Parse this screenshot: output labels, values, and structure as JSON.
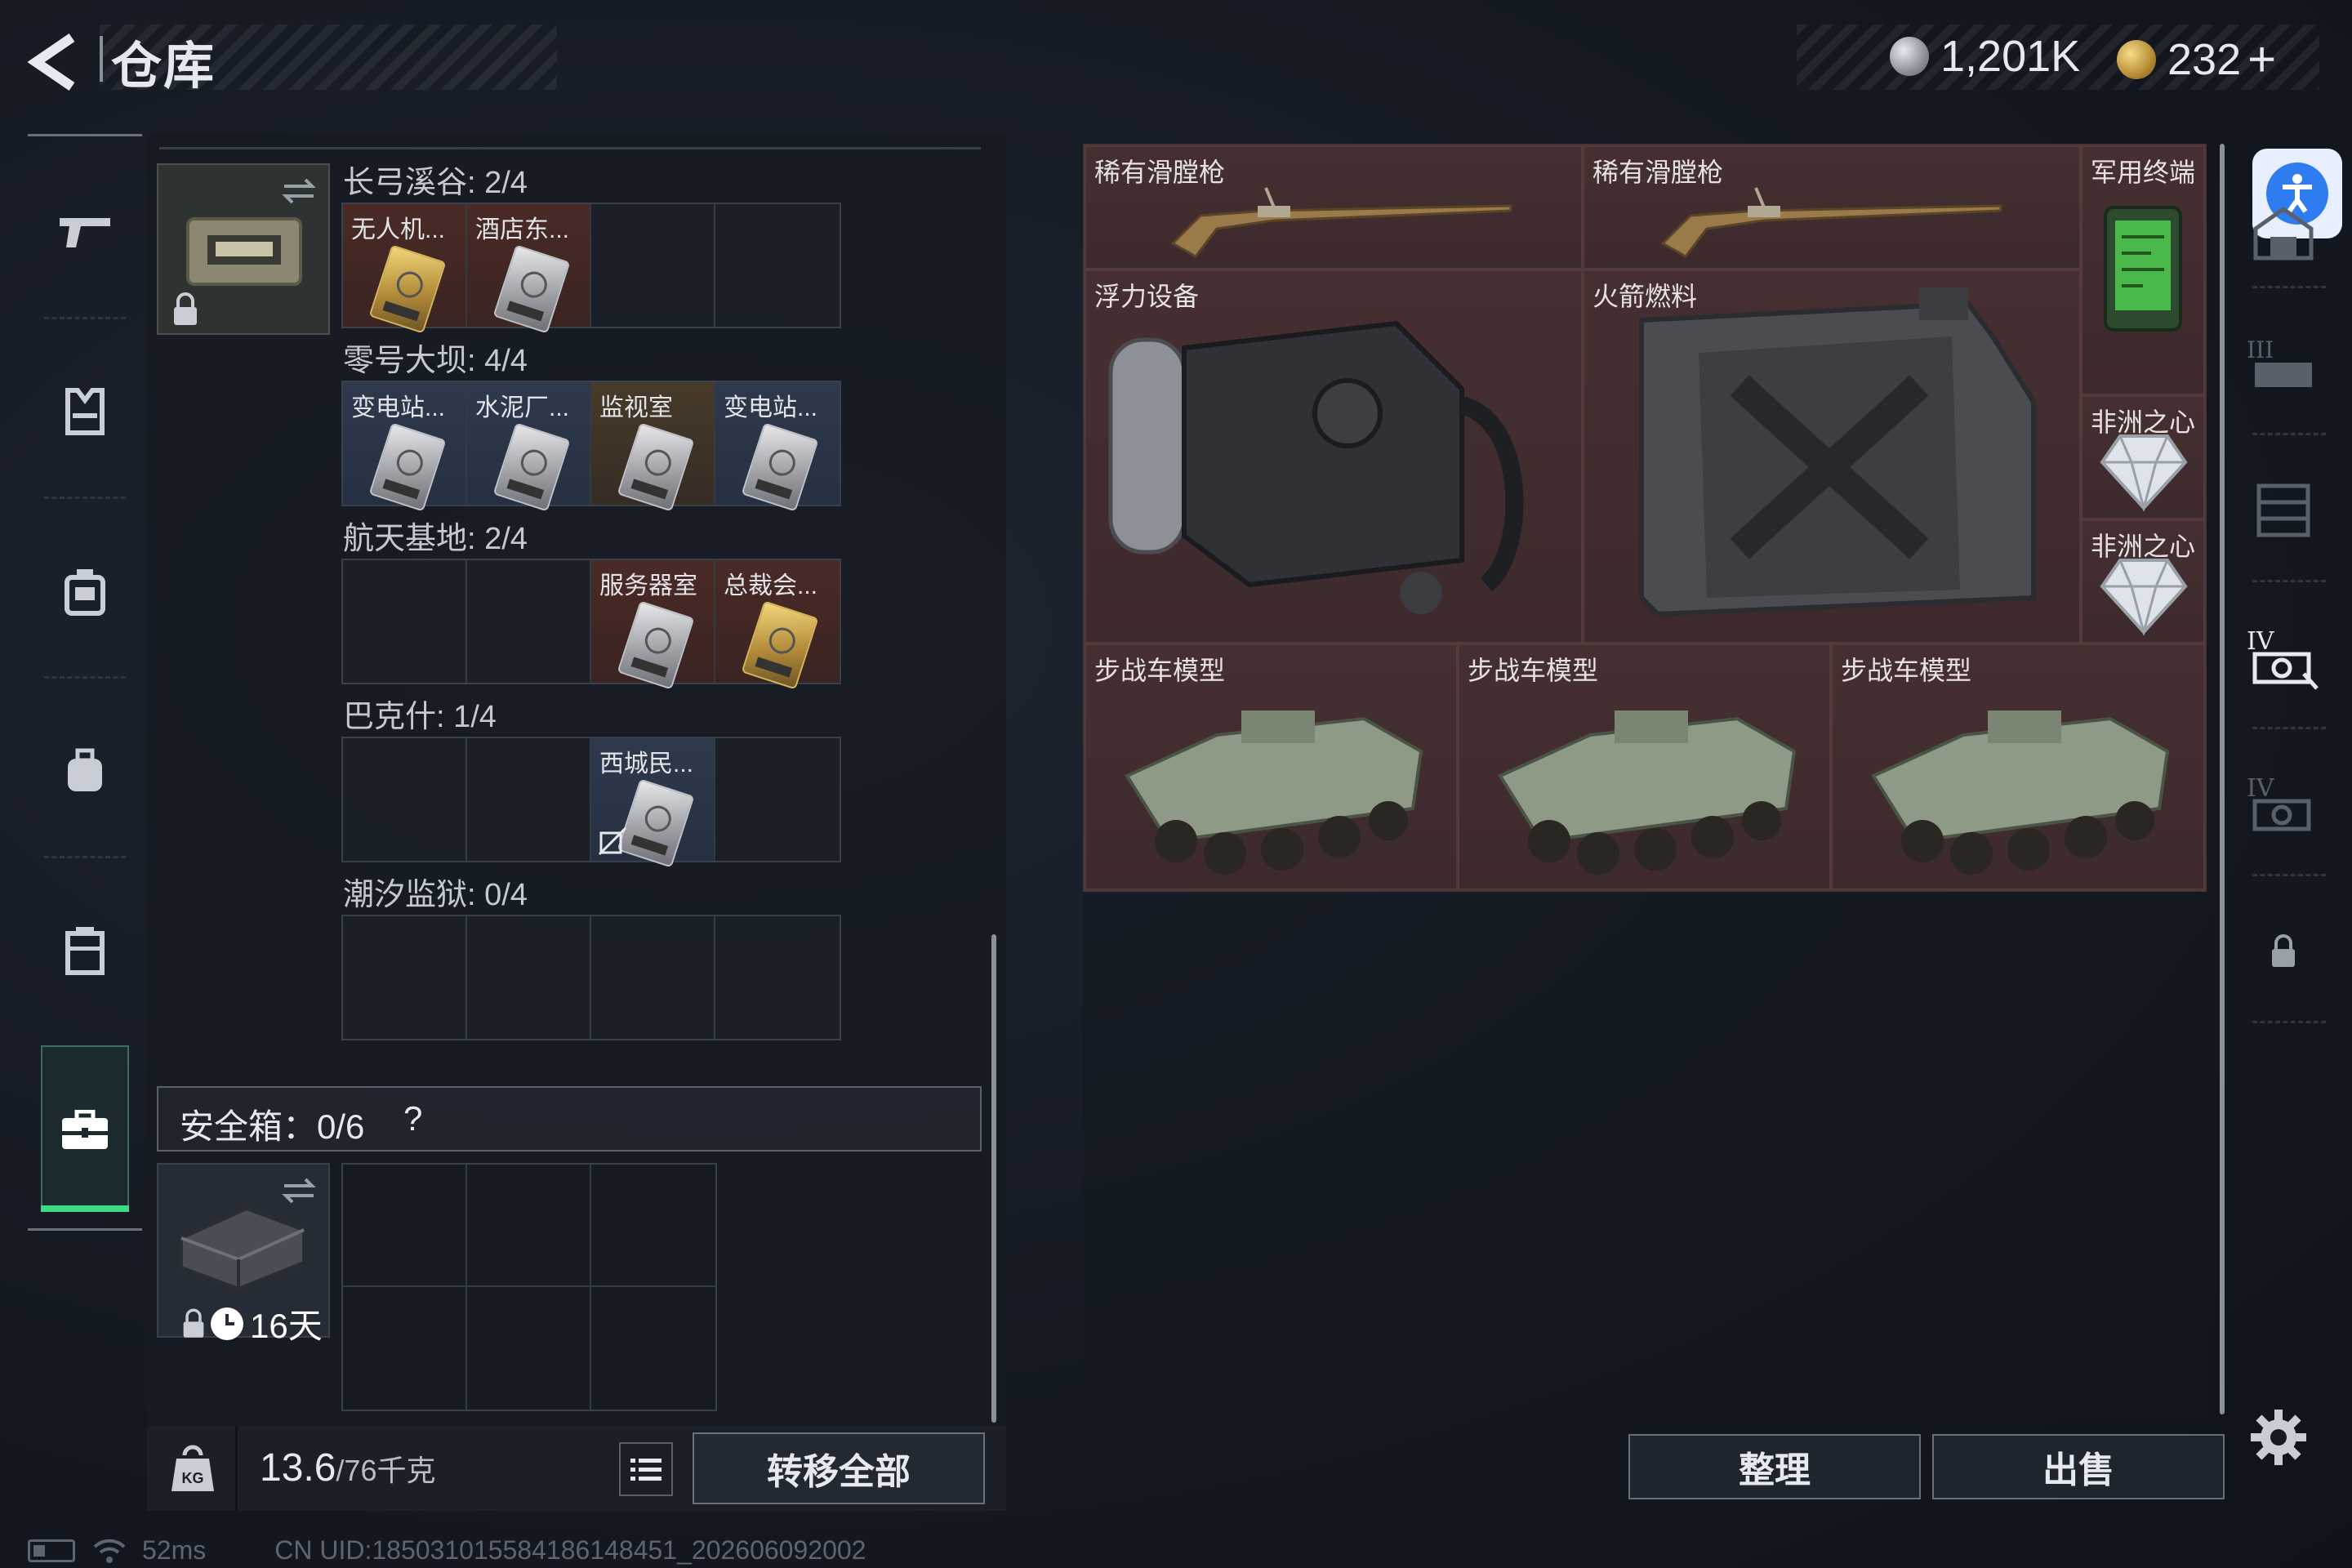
{
  "header": {
    "title": "仓库",
    "currency_silver": "1,201K",
    "currency_gold": "232",
    "currency_plus": "+"
  },
  "sidebar": {
    "items": [
      {
        "name": "weapons-tab",
        "icon": "gun-icon"
      },
      {
        "name": "armor-tab",
        "icon": "armor-vest-icon"
      },
      {
        "name": "rig-tab",
        "icon": "chest-rig-icon"
      },
      {
        "name": "backpack-tab",
        "icon": "backpack-icon"
      },
      {
        "name": "container-tab",
        "icon": "container-icon"
      },
      {
        "name": "case-tab",
        "icon": "briefcase-icon",
        "active": true
      }
    ]
  },
  "keycard_groups": [
    {
      "label": "长弓溪谷: 2/4",
      "cells": [
        {
          "label": "无人机...",
          "tone": "red",
          "card": "gold"
        },
        {
          "label": "酒店东...",
          "tone": "red",
          "card": "silver"
        },
        {
          "label": "",
          "tone": "",
          "card": ""
        },
        {
          "label": "",
          "tone": "",
          "card": ""
        }
      ]
    },
    {
      "label": "零号大坝: 4/4",
      "cells": [
        {
          "label": "变电站...",
          "tone": "blue",
          "card": "silver"
        },
        {
          "label": "水泥厂...",
          "tone": "blue",
          "card": "silver"
        },
        {
          "label": "监视室",
          "tone": "gold",
          "card": "silver"
        },
        {
          "label": "变电站...",
          "tone": "blue",
          "card": "silver"
        }
      ]
    },
    {
      "label": "航天基地: 2/4",
      "cells": [
        {
          "label": "",
          "tone": "",
          "card": ""
        },
        {
          "label": "",
          "tone": "",
          "card": ""
        },
        {
          "label": "服务器室",
          "tone": "red",
          "card": "silver"
        },
        {
          "label": "总裁会...",
          "tone": "red",
          "card": "gold"
        }
      ]
    },
    {
      "label": "巴克什: 1/4",
      "cells": [
        {
          "label": "",
          "tone": "",
          "card": ""
        },
        {
          "label": "",
          "tone": "",
          "card": ""
        },
        {
          "label": "西城民...",
          "tone": "blue",
          "card": "silver"
        },
        {
          "label": "",
          "tone": "",
          "card": ""
        }
      ]
    },
    {
      "label": "潮汐监狱: 0/4",
      "cells": [
        {
          "label": "",
          "tone": "",
          "card": ""
        },
        {
          "label": "",
          "tone": "",
          "card": ""
        },
        {
          "label": "",
          "tone": "",
          "card": ""
        },
        {
          "label": "",
          "tone": "",
          "card": ""
        }
      ]
    }
  ],
  "safe_box": {
    "label": "安全箱：0/6",
    "help": "?",
    "timer": "16天"
  },
  "footer": {
    "weight_value": "13.6",
    "weight_max": "/76千克",
    "transfer_label": "转移全部",
    "sort_label": "整理",
    "sell_label": "出售"
  },
  "status_bar": {
    "ping": "52ms",
    "uid": "CN UID:185031015584186148451_202606092002"
  },
  "storage_items": [
    {
      "label": "稀有滑膛枪",
      "icon": "musket-icon"
    },
    {
      "label": "稀有滑膛枪",
      "icon": "musket-icon"
    },
    {
      "label": "军用终端",
      "icon": "military-terminal-icon"
    },
    {
      "label": "浮力设备",
      "icon": "buoyancy-device-icon"
    },
    {
      "label": "火箭燃料",
      "icon": "rocket-fuel-canister-icon"
    },
    {
      "label": "非洲之心",
      "icon": "diamond-icon"
    },
    {
      "label": "非洲之心",
      "icon": "diamond-icon"
    },
    {
      "label": "步战车模型",
      "icon": "ifv-model-icon"
    },
    {
      "label": "步战车模型",
      "icon": "ifv-model-icon"
    },
    {
      "label": "步战车模型",
      "icon": "ifv-model-icon"
    }
  ],
  "right_sidebar": {
    "items": [
      "warehouse-icon",
      "level-3-storage-icon",
      "level-3-shelf-icon",
      "level-4-storage-icon",
      "level-4-storage-locked-icon",
      "lock-icon"
    ]
  },
  "colors": {
    "accent_green": "#3ddc84",
    "storage_bg": "#3c2a2c",
    "accessibility_blue": "#2f7cf0"
  }
}
